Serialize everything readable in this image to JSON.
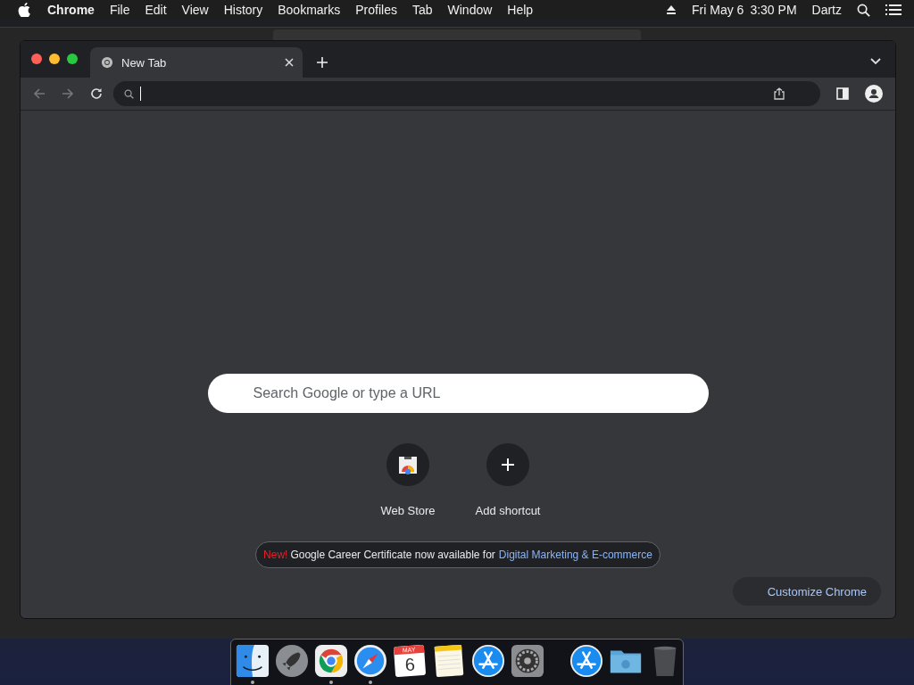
{
  "menu_bar": {
    "app": "Chrome",
    "items": [
      "File",
      "Edit",
      "View",
      "History",
      "Bookmarks",
      "Profiles",
      "Tab",
      "Window",
      "Help"
    ],
    "date": "Fri May 6",
    "time": "3:30 PM",
    "user": "Dartz"
  },
  "browser": {
    "tabs": [
      {
        "title": "New Tab",
        "selected": true
      }
    ]
  },
  "new_tab": {
    "search_placeholder": "Search Google or type a URL",
    "shortcuts": [
      {
        "label": "Web Store",
        "kind": "store"
      },
      {
        "label": "Add shortcut",
        "kind": "add"
      }
    ],
    "promo": {
      "badge": "New!",
      "text": "Google Career Certificate now available for",
      "link": "Digital Marketing & E-commerce"
    },
    "customize_button": "Customize Chrome"
  },
  "dock": {
    "apps": [
      {
        "kind": "finder",
        "running": true
      },
      {
        "kind": "launchpad",
        "running": false
      },
      {
        "kind": "chrome",
        "running": true
      },
      {
        "kind": "safari",
        "running": true
      },
      {
        "kind": "calendar",
        "running": false,
        "month": "MAY",
        "day": "6"
      },
      {
        "kind": "notes",
        "running": false
      },
      {
        "kind": "appstore",
        "running": false
      },
      {
        "kind": "settings",
        "running": false
      },
      {
        "kind": "separator"
      },
      {
        "kind": "appstore",
        "running": false
      },
      {
        "kind": "folder",
        "running": false
      },
      {
        "kind": "trash",
        "running": false
      }
    ]
  }
}
